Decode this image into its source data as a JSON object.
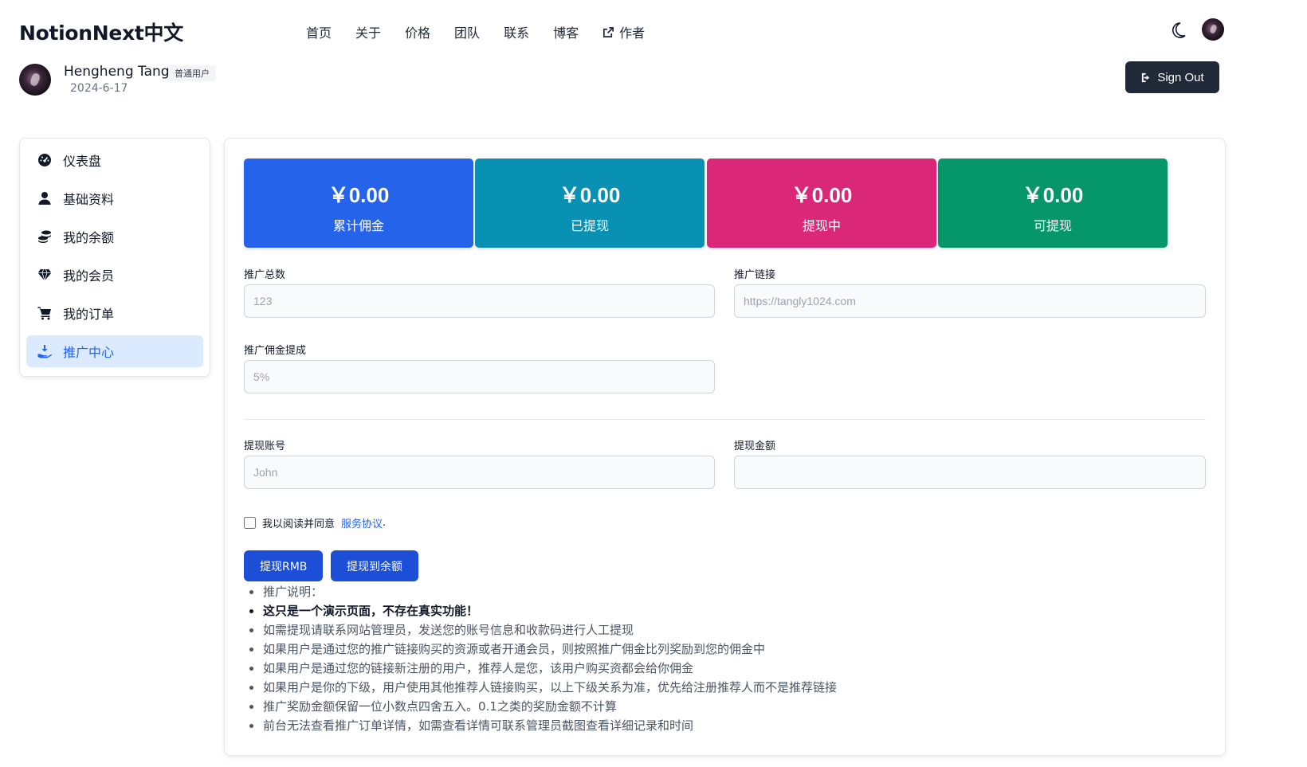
{
  "brand": "NotionNext中文",
  "nav": {
    "items": [
      "首页",
      "关于",
      "价格",
      "团队",
      "联系",
      "博客"
    ],
    "author_label": "作者"
  },
  "icons": {
    "theme_toggle": "moon-icon",
    "external_link": "external-link-icon",
    "sign_out": "sign-out-icon"
  },
  "user": {
    "name": "Hengheng Tang",
    "badge": "普通用户",
    "date": "2024-6-17"
  },
  "signout_label": "Sign Out",
  "sidebar": {
    "items": [
      {
        "label": "仪表盘",
        "icon": "dashboard-icon"
      },
      {
        "label": "基础资料",
        "icon": "user-icon"
      },
      {
        "label": "我的余额",
        "icon": "coins-icon"
      },
      {
        "label": "我的会员",
        "icon": "gem-icon"
      },
      {
        "label": "我的订单",
        "icon": "cart-icon"
      },
      {
        "label": "推广中心",
        "icon": "hand-holding-icon"
      }
    ],
    "active_index": 5
  },
  "stats": [
    {
      "amount": "￥0.00",
      "label": "累计佣金",
      "color": "#2563eb"
    },
    {
      "amount": "￥0.00",
      "label": "已提现",
      "color": "#0891b2"
    },
    {
      "amount": "￥0.00",
      "label": "提现中",
      "color": "#db2777"
    },
    {
      "amount": "￥0.00",
      "label": "可提现",
      "color": "#059669"
    }
  ],
  "form": {
    "promo_total": {
      "label": "推广总数",
      "placeholder": "123"
    },
    "promo_link": {
      "label": "推广链接",
      "placeholder": "https://tangly1024.com"
    },
    "commission_rate": {
      "label": "推广佣金提成",
      "placeholder": "5%"
    },
    "withdraw_account": {
      "label": "提现账号",
      "placeholder": "John"
    },
    "withdraw_amount": {
      "label": "提现金额",
      "placeholder": ""
    },
    "agree_text": "我以阅读并同意",
    "agree_link": "服务协议",
    "agree_suffix": ".",
    "btn_rmb": "提现RMB",
    "btn_balance": "提现到余额"
  },
  "notes": [
    "推广说明：",
    "这只是一个演示页面，不存在真实功能！",
    "如需提现请联系网站管理员，发送您的账号信息和收款码进行人工提现",
    "如果用户是通过您的推广链接购买的资源或者开通会员，则按照推广佣金比列奖励到您的佣金中",
    "如果用户是通过您的链接新注册的用户，推荐人是您，该用户购买资都会给你佣金",
    "如果用户是你的下级，用户使用其他推荐人链接购买，以上下级关系为准，优先给注册推荐人而不是推荐链接",
    "推广奖励金额保留一位小数点四舍五入。0.1之类的奖励金额不计算",
    "前台无法查看推广订单详情，如需查看详情可联系管理员截图查看详细记录和时间"
  ]
}
